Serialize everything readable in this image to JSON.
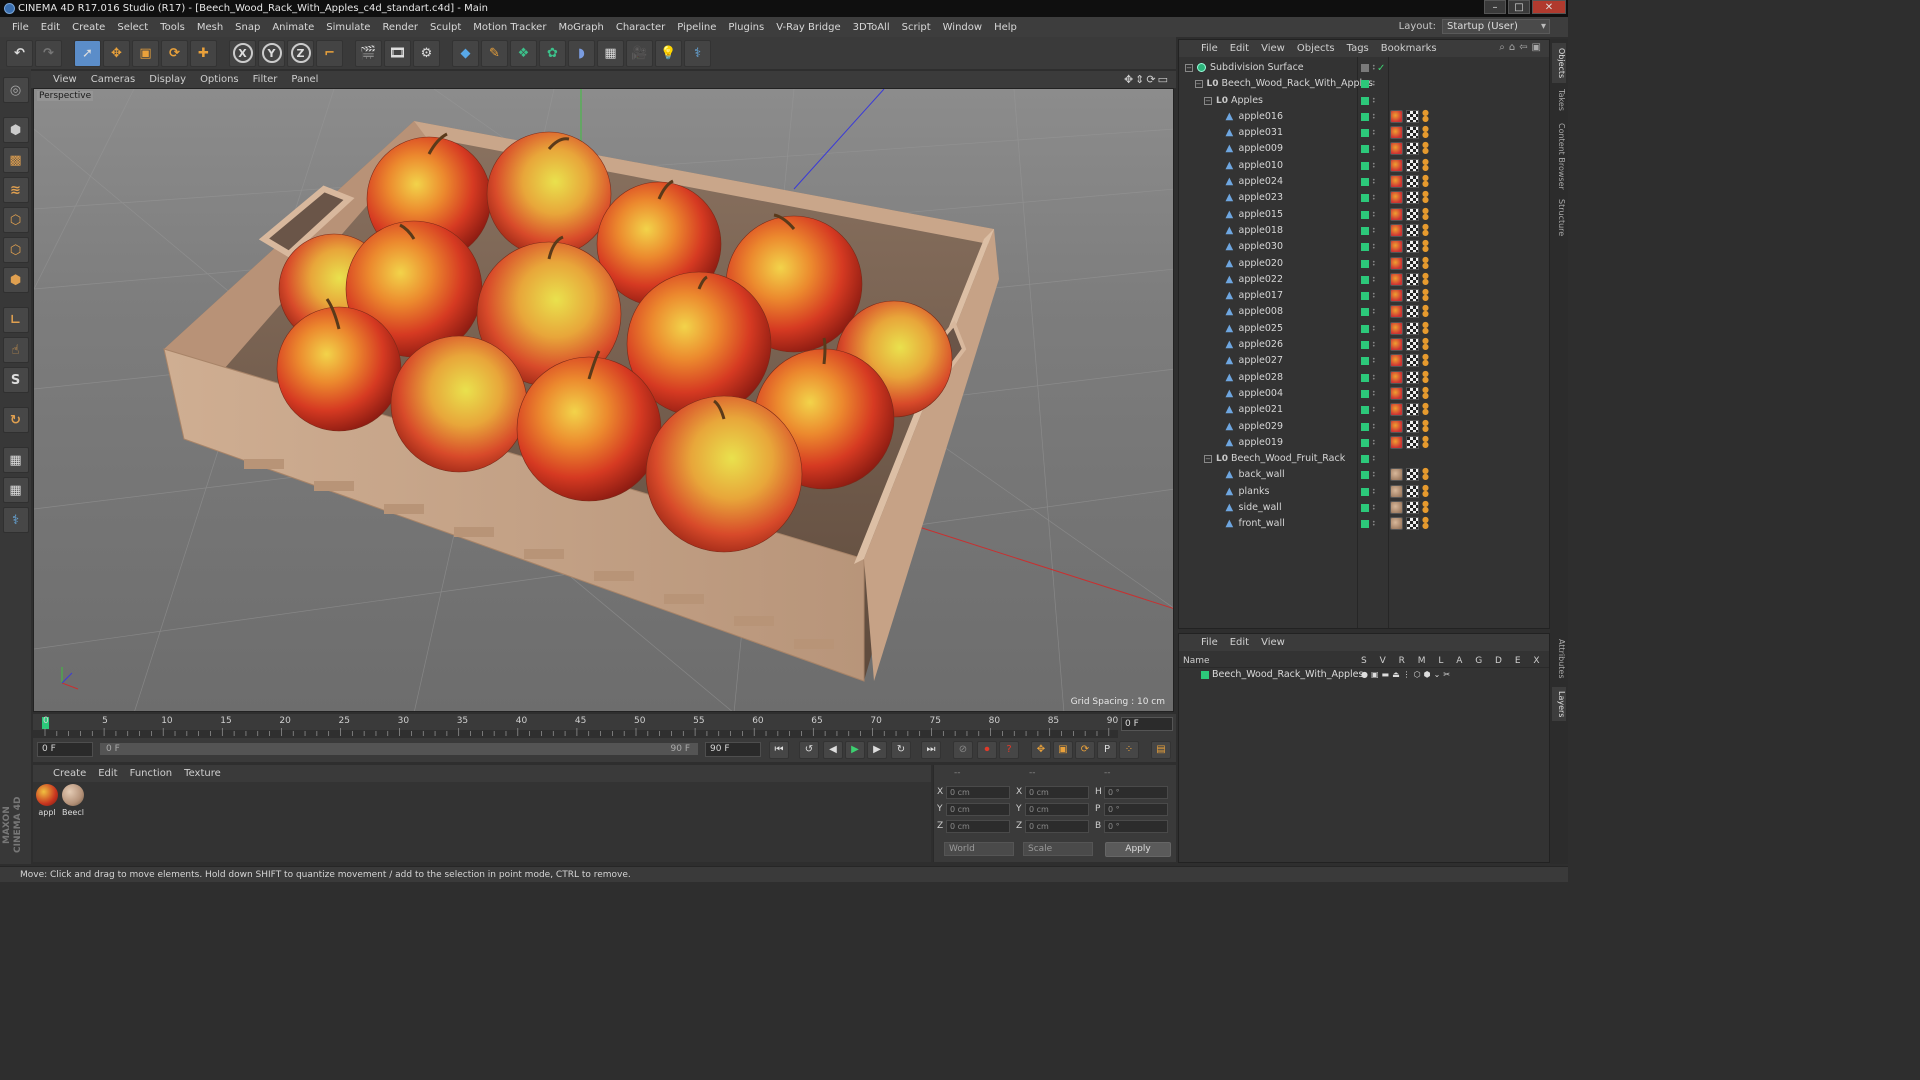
{
  "window": {
    "title": "CINEMA 4D R17.016 Studio (R17) - [Beech_Wood_Rack_With_Apples_c4d_standart.c4d] - Main",
    "buttons": [
      "–",
      "□",
      "✕"
    ]
  },
  "menubar": {
    "items": [
      "File",
      "Edit",
      "Create",
      "Select",
      "Tools",
      "Mesh",
      "Snap",
      "Animate",
      "Simulate",
      "Render",
      "Sculpt",
      "Motion Tracker",
      "MoGraph",
      "Character",
      "Pipeline",
      "Plugins",
      "V-Ray Bridge",
      "3DToAll",
      "Script",
      "Window",
      "Help"
    ],
    "layout_label": "Layout:",
    "layout_value": "Startup (User)"
  },
  "toolbar": {
    "axis_x": "X",
    "axis_y": "Y",
    "axis_z": "Z"
  },
  "viewport": {
    "menu": [
      "View",
      "Cameras",
      "Display",
      "Options",
      "Filter",
      "Panel"
    ],
    "label": "Perspective",
    "grid_spacing": "Grid Spacing : 10 cm"
  },
  "timeline": {
    "ticks": [
      "0",
      "5",
      "10",
      "15",
      "20",
      "25",
      "30",
      "35",
      "40",
      "45",
      "50",
      "55",
      "60",
      "65",
      "70",
      "75",
      "80",
      "85",
      "90"
    ],
    "current_frame": "0 F",
    "start_field": "0 F",
    "range_start": "0 F",
    "range_end": "90 F",
    "end_field": "90 F"
  },
  "material_manager": {
    "menu": [
      "Create",
      "Edit",
      "Function",
      "Texture"
    ],
    "materials": [
      {
        "label": "appl",
        "color": "#c8341f"
      },
      {
        "label": "Beecl",
        "color": "#b59279"
      }
    ]
  },
  "coordinates": {
    "header": [
      "--",
      "--",
      "--"
    ],
    "rows": [
      {
        "a": "X",
        "av": "0 cm",
        "b": "X",
        "bv": "0 cm",
        "c": "H",
        "cv": "0 °"
      },
      {
        "a": "Y",
        "av": "0 cm",
        "b": "Y",
        "bv": "0 cm",
        "c": "P",
        "cv": "0 °"
      },
      {
        "a": "Z",
        "av": "0 cm",
        "b": "Z",
        "bv": "0 cm",
        "c": "B",
        "cv": "0 °"
      }
    ],
    "mode": "World",
    "scale": "Scale",
    "apply": "Apply"
  },
  "status": "Move: Click and drag to move elements. Hold down SHIFT to quantize movement / add to the selection in point mode, CTRL to remove.",
  "object_manager": {
    "menu": [
      "File",
      "Edit",
      "View",
      "Objects",
      "Tags",
      "Bookmarks"
    ],
    "objects": [
      {
        "name": "Subdivision Surface",
        "indent": 0,
        "kind": "subd",
        "tag": "none"
      },
      {
        "name": "Beech_Wood_Rack_With_Apples",
        "indent": 1,
        "kind": "null",
        "tag": "none"
      },
      {
        "name": "Apples",
        "indent": 2,
        "kind": "null",
        "tag": "none"
      },
      {
        "name": "apple016",
        "indent": 3,
        "kind": "mesh",
        "tag": "apple"
      },
      {
        "name": "apple031",
        "indent": 3,
        "kind": "mesh",
        "tag": "apple"
      },
      {
        "name": "apple009",
        "indent": 3,
        "kind": "mesh",
        "tag": "apple"
      },
      {
        "name": "apple010",
        "indent": 3,
        "kind": "mesh",
        "tag": "apple"
      },
      {
        "name": "apple024",
        "indent": 3,
        "kind": "mesh",
        "tag": "apple"
      },
      {
        "name": "apple023",
        "indent": 3,
        "kind": "mesh",
        "tag": "apple"
      },
      {
        "name": "apple015",
        "indent": 3,
        "kind": "mesh",
        "tag": "apple"
      },
      {
        "name": "apple018",
        "indent": 3,
        "kind": "mesh",
        "tag": "apple"
      },
      {
        "name": "apple030",
        "indent": 3,
        "kind": "mesh",
        "tag": "apple"
      },
      {
        "name": "apple020",
        "indent": 3,
        "kind": "mesh",
        "tag": "apple"
      },
      {
        "name": "apple022",
        "indent": 3,
        "kind": "mesh",
        "tag": "apple"
      },
      {
        "name": "apple017",
        "indent": 3,
        "kind": "mesh",
        "tag": "apple"
      },
      {
        "name": "apple008",
        "indent": 3,
        "kind": "mesh",
        "tag": "apple"
      },
      {
        "name": "apple025",
        "indent": 3,
        "kind": "mesh",
        "tag": "apple"
      },
      {
        "name": "apple026",
        "indent": 3,
        "kind": "mesh",
        "tag": "apple"
      },
      {
        "name": "apple027",
        "indent": 3,
        "kind": "mesh",
        "tag": "apple"
      },
      {
        "name": "apple028",
        "indent": 3,
        "kind": "mesh",
        "tag": "apple"
      },
      {
        "name": "apple004",
        "indent": 3,
        "kind": "mesh",
        "tag": "apple"
      },
      {
        "name": "apple021",
        "indent": 3,
        "kind": "mesh",
        "tag": "apple"
      },
      {
        "name": "apple029",
        "indent": 3,
        "kind": "mesh",
        "tag": "apple"
      },
      {
        "name": "apple019",
        "indent": 3,
        "kind": "mesh",
        "tag": "apple"
      },
      {
        "name": "Beech_Wood_Fruit_Rack",
        "indent": 2,
        "kind": "null",
        "tag": "none"
      },
      {
        "name": "back_wall",
        "indent": 3,
        "kind": "mesh",
        "tag": "wood"
      },
      {
        "name": "planks",
        "indent": 3,
        "kind": "mesh",
        "tag": "wood"
      },
      {
        "name": "side_wall",
        "indent": 3,
        "kind": "mesh",
        "tag": "wood"
      },
      {
        "name": "front_wall",
        "indent": 3,
        "kind": "mesh",
        "tag": "wood"
      }
    ]
  },
  "layer_manager": {
    "menu": [
      "File",
      "Edit",
      "View"
    ],
    "header_name": "Name",
    "header_cols": "S V R M L A G D E X",
    "layer_name": "Beech_Wood_Rack_With_Apples"
  },
  "side_tabs": [
    "Objects",
    "Takes",
    "Content Browser",
    "Structure",
    "Attributes",
    "Layers"
  ],
  "brand": "MAXON CINEMA 4D"
}
